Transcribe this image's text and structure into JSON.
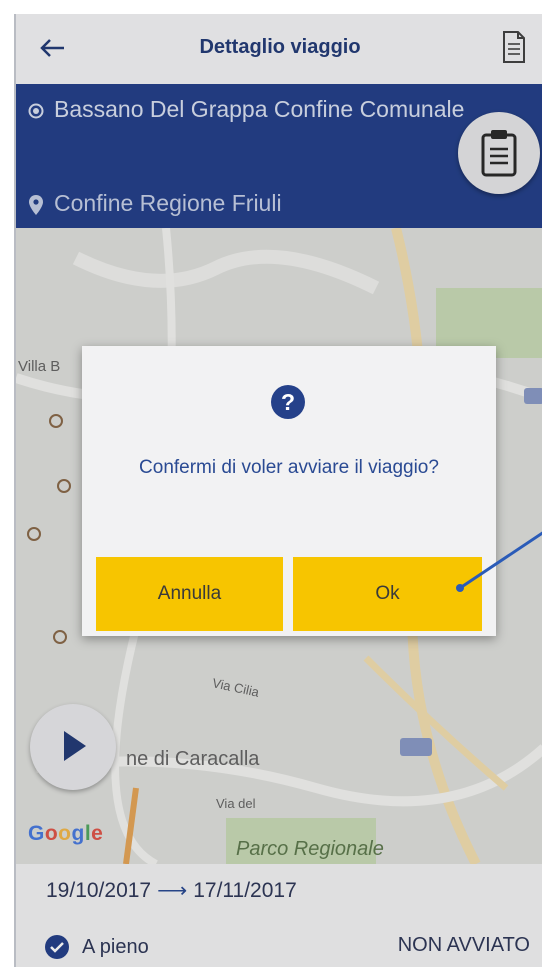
{
  "appbar": {
    "title": "Dettaglio viaggio"
  },
  "route": {
    "origin": "Bassano Del Grappa Confine Comunale",
    "destination": "Confine Regione Friuli"
  },
  "map": {
    "labels": [
      "Villa B",
      "ne di Caracalla",
      "Parco Regionale",
      "Via Cilia",
      "Via del"
    ],
    "google": "Google"
  },
  "dialog": {
    "message": "Confermi di voler avviare il viaggio?",
    "cancel_label": "Annulla",
    "ok_label": "Ok"
  },
  "footer": {
    "start_date": "19/10/2017",
    "end_date": "17/11/2017",
    "full_label": "A pieno",
    "status": "NON AVVIATO"
  },
  "colors": {
    "primary": "#25418a",
    "accent": "#f7c500",
    "text_dark": "#243c78"
  }
}
